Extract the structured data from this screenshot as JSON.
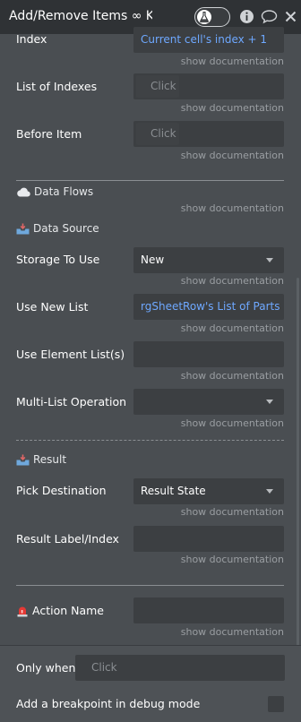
{
  "header": {
    "title": "Add/Remove Items ∞ Ke",
    "toggle_on": false
  },
  "rows": {
    "index": {
      "label": "Index",
      "value": "Current cell's index + 1",
      "doc": "show documentation"
    },
    "list_of_indexes": {
      "label": "List of Indexes",
      "placeholder": "Click",
      "doc": "show documentation"
    },
    "before_item": {
      "label": "Before Item",
      "placeholder": "Click",
      "doc": "show documentation"
    }
  },
  "data_flows": {
    "title": "Data Flows",
    "doc": "show documentation"
  },
  "data_source": {
    "title": "Data Source",
    "storage_to_use": {
      "label": "Storage To Use",
      "value": "New",
      "doc": "show documentation"
    },
    "use_new_list": {
      "label": "Use New List",
      "value": "rgSheetRow's List of Parts",
      "doc": "show documentation"
    },
    "use_element_lists": {
      "label": "Use Element List(s)",
      "value": "",
      "doc": "show documentation"
    },
    "multi_list_operation": {
      "label": "Multi-List Operation",
      "value": "",
      "doc": "show documentation"
    }
  },
  "result": {
    "title": "Result",
    "pick_destination": {
      "label": "Pick Destination",
      "value": "Result State",
      "doc": "show documentation"
    },
    "result_label_index": {
      "label": "Result Label/Index",
      "value": "",
      "doc": "show documentation"
    }
  },
  "action": {
    "label": "Action Name",
    "value": "",
    "doc": "show documentation"
  },
  "footer": {
    "only_when_label": "Only when",
    "only_when_placeholder": "Click",
    "breakpoint_label": "Add a breakpoint in debug mode"
  },
  "colors": {
    "accent_link": "#6ea8ff",
    "panel": "#4a4e52",
    "header": "#2f3235"
  }
}
